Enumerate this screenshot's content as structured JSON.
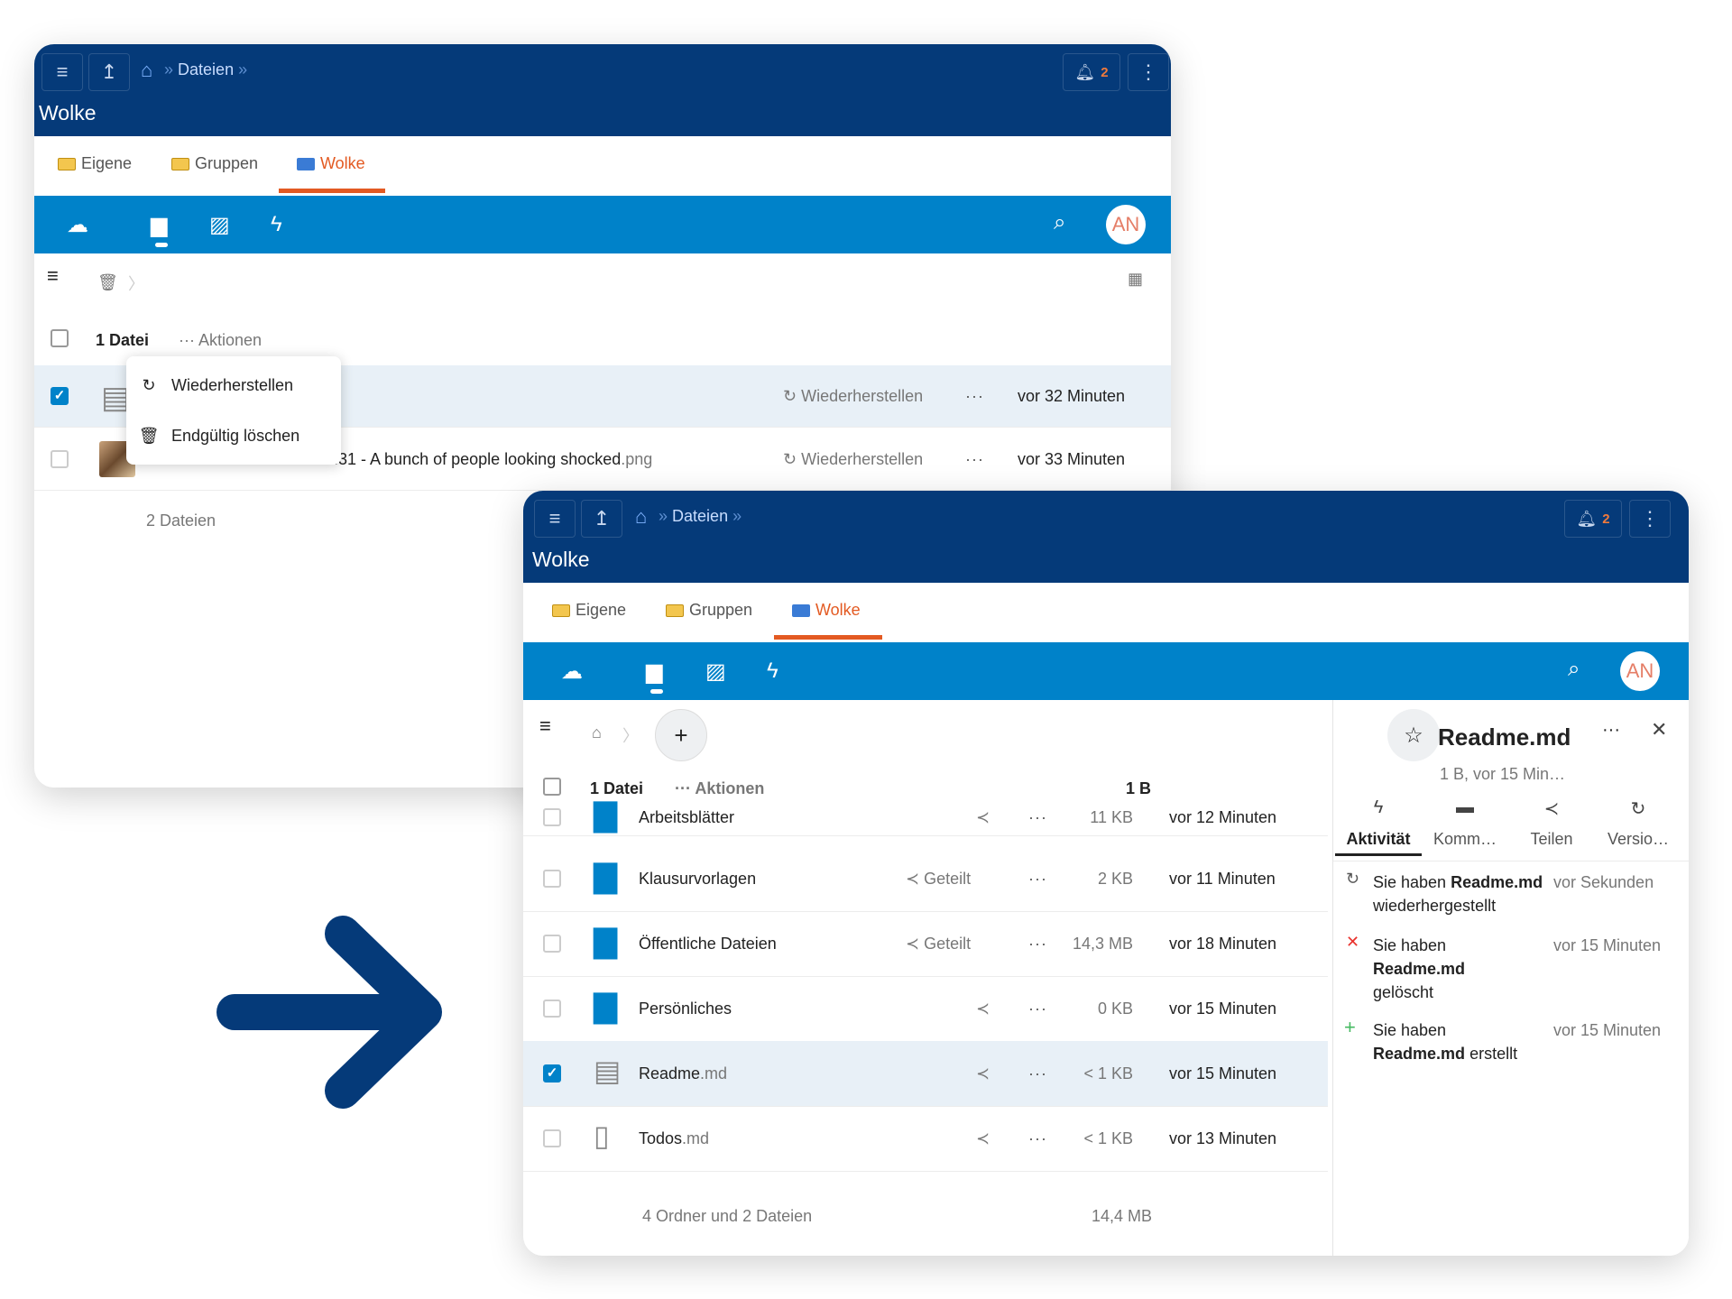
{
  "window_back": {
    "breadcrumb": {
      "home_icon": "home-icon",
      "label": "Dateien",
      "sep": "»"
    },
    "notifications": {
      "count": "2"
    },
    "app_title": "Wolke",
    "tabs": [
      {
        "label": "Eigene"
      },
      {
        "label": "Gruppen"
      },
      {
        "label": "Wolke"
      }
    ],
    "avatar": "AN",
    "list_header": {
      "count": "1 Datei",
      "actions": "Aktionen"
    },
    "context_menu": [
      {
        "label": "Wiederherstellen",
        "icon": "restore-icon"
      },
      {
        "label": "Endgültig löschen",
        "icon": "trash-icon"
      }
    ],
    "rows": [
      {
        "name": "",
        "action": "Wiederherstellen",
        "time": "vor 32 Minuten",
        "selected": true
      },
      {
        "name": "7.31 - A bunch of people looking shocked",
        "ext": ".png",
        "action": "Wiederherstellen",
        "time": "vor 33 Minuten",
        "selected": false
      }
    ],
    "footer": "2 Dateien"
  },
  "window_front": {
    "breadcrumb": {
      "home_icon": "home-icon",
      "label": "Dateien",
      "sep": "»"
    },
    "notifications": {
      "count": "2"
    },
    "app_title": "Wolke",
    "tabs": [
      {
        "label": "Eigene"
      },
      {
        "label": "Gruppen"
      },
      {
        "label": "Wolke"
      }
    ],
    "avatar": "AN",
    "add_button": "+",
    "list_header": {
      "count": "1 Datei",
      "actions": "Aktionen",
      "size": "1 B"
    },
    "rows": [
      {
        "name": "Arbeitsblätter",
        "ext": "",
        "share": "",
        "size": "11 KB",
        "time": "vor 12 Minuten",
        "icon": "folder-icon",
        "selected": false
      },
      {
        "name": "Klausurvorlagen",
        "ext": "",
        "share": "Geteilt",
        "size": "2 KB",
        "time": "vor 11 Minuten",
        "icon": "shared-folder-icon",
        "selected": false
      },
      {
        "name": "Öffentliche Dateien",
        "ext": "",
        "share": "Geteilt",
        "size": "14,3 MB",
        "time": "vor 18 Minuten",
        "icon": "link-folder-icon",
        "selected": false
      },
      {
        "name": "Persönliches",
        "ext": "",
        "share": "",
        "size": "0 KB",
        "time": "vor 15 Minuten",
        "icon": "folder-icon",
        "selected": false
      },
      {
        "name": "Readme",
        "ext": ".md",
        "share": "",
        "size": "< 1 KB",
        "time": "vor 15 Minuten",
        "icon": "text-file-icon",
        "selected": true
      },
      {
        "name": "Todos",
        "ext": ".md",
        "share": "",
        "size": "< 1 KB",
        "time": "vor 13 Minuten",
        "icon": "blank-file-icon",
        "selected": false
      }
    ],
    "footer": {
      "summary": "4 Ordner und 2 Dateien",
      "total": "14,4 MB"
    },
    "sidebar": {
      "title": "Readme.md",
      "subtitle": "1 B, vor 15 Min…",
      "tabs": [
        {
          "label": "Aktivität",
          "icon": "activity-icon"
        },
        {
          "label": "Komm…",
          "icon": "comment-icon"
        },
        {
          "label": "Teilen",
          "icon": "share-icon"
        },
        {
          "label": "Versio…",
          "icon": "history-icon"
        }
      ],
      "activities": [
        {
          "pre": "Sie haben",
          "file": "Readme.md",
          "post": "wiederhergestellt",
          "time": "vor Sekunden",
          "icon": "restore-icon"
        },
        {
          "pre": "Sie haben",
          "file": "Readme.md",
          "post": "gelöscht",
          "time": "vor 15 Minuten",
          "icon": "deleted-icon",
          "color": "#e9322d"
        },
        {
          "pre": "Sie haben",
          "file": "Readme.md",
          "post": "erstellt",
          "time": "vor 15 Minuten",
          "icon": "created-icon",
          "color": "#46ba61"
        }
      ]
    }
  },
  "colors": {
    "header": "#053a79",
    "nav": "#0082c9",
    "accent": "#e35a22",
    "arrow": "#053a79"
  }
}
